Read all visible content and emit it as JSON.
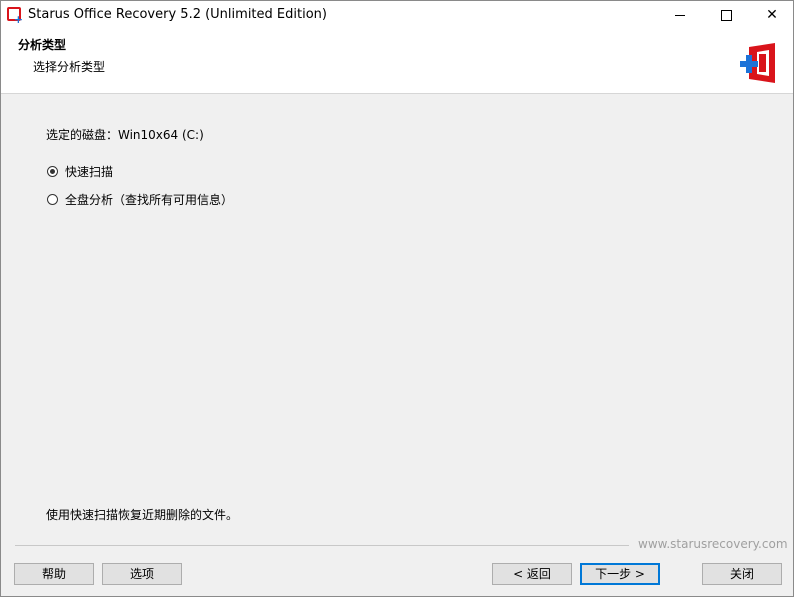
{
  "window": {
    "title": "Starus Office Recovery 5.2 (Unlimited Edition)",
    "caption_minimize": "",
    "caption_maximize": "",
    "caption_close": "✕"
  },
  "header": {
    "title": "分析类型",
    "subtitle": "选择分析类型"
  },
  "content": {
    "selected_disk": "选定的磁盘：Win10x64 (C:)",
    "options": [
      {
        "label": "快速扫描",
        "checked": true
      },
      {
        "label": "全盘分析（查找所有可用信息）",
        "checked": false
      }
    ],
    "hint": "使用快速扫描恢复近期删除的文件。"
  },
  "footer": {
    "website": "www.starusrecovery.com",
    "help_label": "帮助",
    "options_label": "选项",
    "back_label": "< 返回",
    "next_label": "下一步 >",
    "close_label": "关闭"
  },
  "colors": {
    "accent": "#0078d7",
    "logo_red": "#d9141b",
    "logo_blue": "#1d73d8"
  }
}
